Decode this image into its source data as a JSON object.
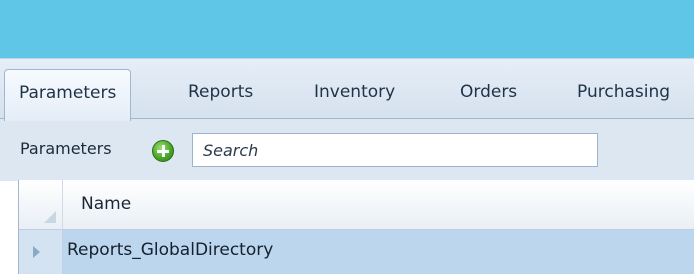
{
  "tabs": [
    {
      "label": "Parameters",
      "active": true
    },
    {
      "label": "Reports",
      "active": false
    },
    {
      "label": "Inventory",
      "active": false
    },
    {
      "label": "Orders",
      "active": false
    },
    {
      "label": "Purchasing",
      "active": false
    }
  ],
  "toolbar": {
    "label": "Parameters",
    "add_icon": "plus-circle-icon",
    "search_placeholder": "Search",
    "search_value": ""
  },
  "grid": {
    "columns": [
      "Name"
    ],
    "rows": [
      {
        "name": "Reports_GlobalDirectory",
        "selected": true
      }
    ]
  },
  "colors": {
    "titlebar": "#5fc6e8",
    "tabstrip": "#d5e1ee",
    "selected_row": "#bcd6ee",
    "add_icon": "#4aa829"
  }
}
